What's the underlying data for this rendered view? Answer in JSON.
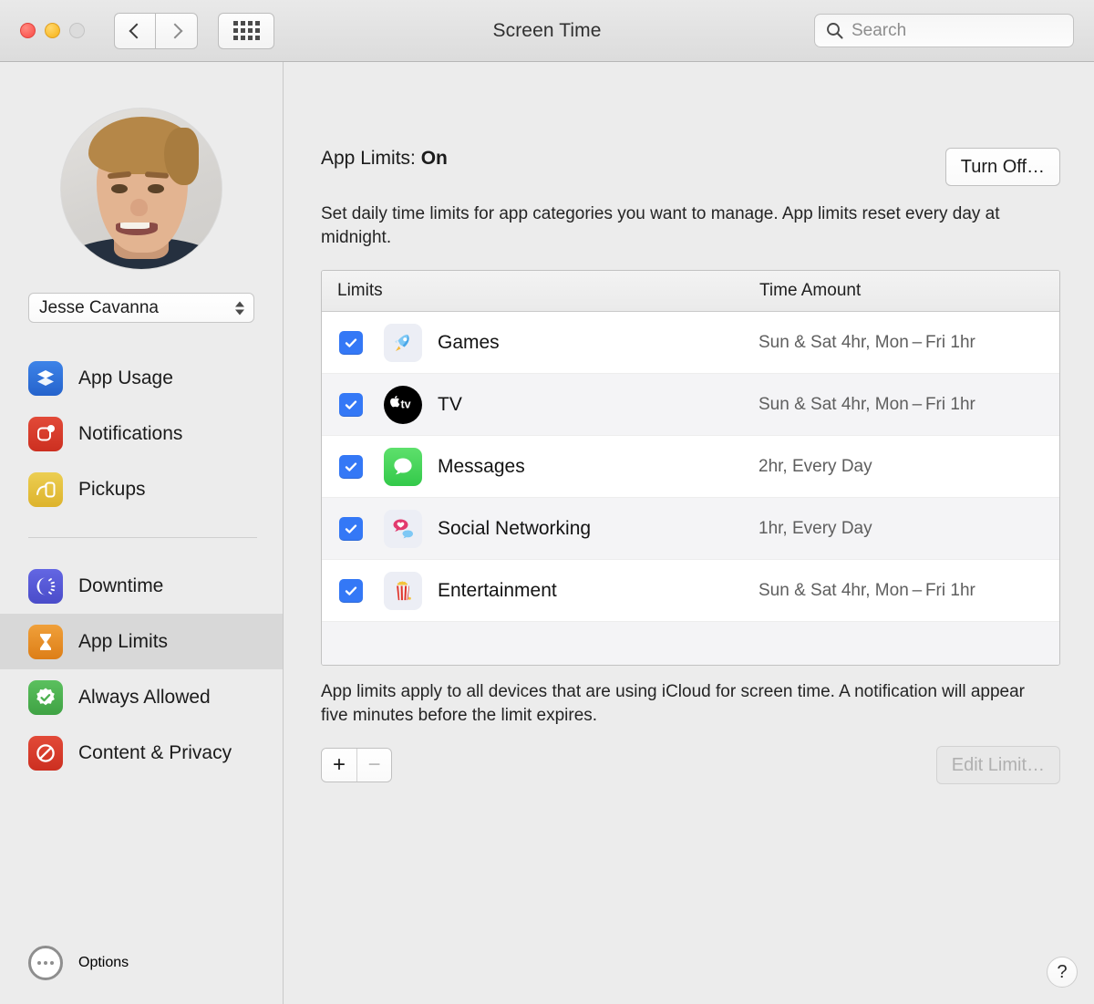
{
  "window": {
    "title": "Screen Time",
    "traffic_lights": [
      "close",
      "minimize",
      "zoom"
    ],
    "nav": {
      "back": "back-icon",
      "forward": "forward-icon",
      "grid": "show-all-icon"
    }
  },
  "search": {
    "placeholder": "Search",
    "value": "",
    "icon": "search-icon"
  },
  "sidebar": {
    "user": {
      "name": "Jesse Cavanna",
      "avatar": "user-avatar"
    },
    "items": [
      {
        "label": "App Usage",
        "icon": "app-usage-icon",
        "selected": false
      },
      {
        "label": "Notifications",
        "icon": "notifications-icon",
        "selected": false
      },
      {
        "label": "Pickups",
        "icon": "pickups-icon",
        "selected": false
      },
      {
        "label": "Downtime",
        "icon": "downtime-icon",
        "selected": false
      },
      {
        "label": "App Limits",
        "icon": "app-limits-icon",
        "selected": true
      },
      {
        "label": "Always Allowed",
        "icon": "always-allowed-icon",
        "selected": false
      },
      {
        "label": "Content & Privacy",
        "icon": "content-privacy-icon",
        "selected": false
      }
    ],
    "options": {
      "label": "Options",
      "icon": "options-ellipsis-icon"
    }
  },
  "main": {
    "status_prefix": "App Limits:",
    "status_value": "On",
    "turn_off_label": "Turn Off…",
    "description": "Set daily time limits for app categories you want to manage. App limits reset every day at midnight.",
    "table": {
      "headers": {
        "limits": "Limits",
        "time_amount": "Time Amount"
      },
      "rows": [
        {
          "checked": true,
          "icon": "games-rocket-icon",
          "name": "Games",
          "time": "Sun & Sat 4hr, Mon – Fri 1hr"
        },
        {
          "checked": true,
          "icon": "apple-tv-icon",
          "name": "TV",
          "time": "Sun & Sat 4hr, Mon – Fri 1hr"
        },
        {
          "checked": true,
          "icon": "messages-bubble-icon",
          "name": "Messages",
          "time": "2hr, Every Day"
        },
        {
          "checked": true,
          "icon": "social-networking-icon",
          "name": "Social Networking",
          "time": "1hr, Every Day"
        },
        {
          "checked": true,
          "icon": "entertainment-popcorn-icon",
          "name": "Entertainment",
          "time": "Sun & Sat 4hr, Mon – Fri 1hr"
        }
      ]
    },
    "footnote": "App limits apply to all devices that are using iCloud for screen time. A notification will appear five minutes before the limit expires.",
    "add_label": "+",
    "remove_label": "−",
    "edit_limit_label": "Edit Limit…",
    "help_label": "?"
  },
  "colors": {
    "accent_blue": "#3478f6",
    "app_usage": "#2f6fd8",
    "notifications": "#d93b2b",
    "pickups": "#e8c03a",
    "downtime": "#5558d6",
    "app_limits": "#e8902a",
    "always_allowed": "#4cb050",
    "content_privacy": "#d93b2b",
    "messages_green": "#4cd964",
    "social_pink": "#e23a6e",
    "window_bg": "#ececec",
    "row_alt": "#f4f4f6"
  }
}
